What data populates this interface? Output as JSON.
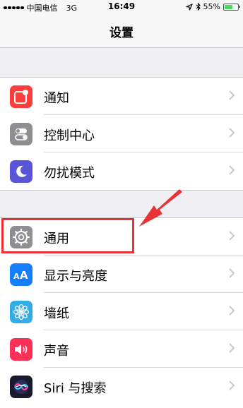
{
  "status_bar": {
    "carrier": "中国电信",
    "network": "3G",
    "time": "16:49",
    "battery": "55%"
  },
  "nav": {
    "title": "设置"
  },
  "group1": {
    "items": [
      {
        "label": "通知",
        "icon": "notifications-icon",
        "color": "#fc3d39"
      },
      {
        "label": "控制中心",
        "icon": "control-center-icon",
        "color": "#8e8e93"
      },
      {
        "label": "勿扰模式",
        "icon": "moon-icon",
        "color": "#5856d6"
      }
    ]
  },
  "group2": {
    "items": [
      {
        "label": "通用",
        "icon": "gear-icon",
        "color": "#8e8e93"
      },
      {
        "label": "显示与亮度",
        "icon": "display-brightness-icon",
        "color": "#147efb"
      },
      {
        "label": "墙纸",
        "icon": "wallpaper-icon",
        "color": "#32ade6"
      },
      {
        "label": "声音",
        "icon": "sound-icon",
        "color": "#fc3158"
      },
      {
        "label": "Siri 与搜索",
        "icon": "siri-icon",
        "color": "#1a1a2e"
      }
    ]
  },
  "annotation": {
    "color": "#e83236"
  }
}
